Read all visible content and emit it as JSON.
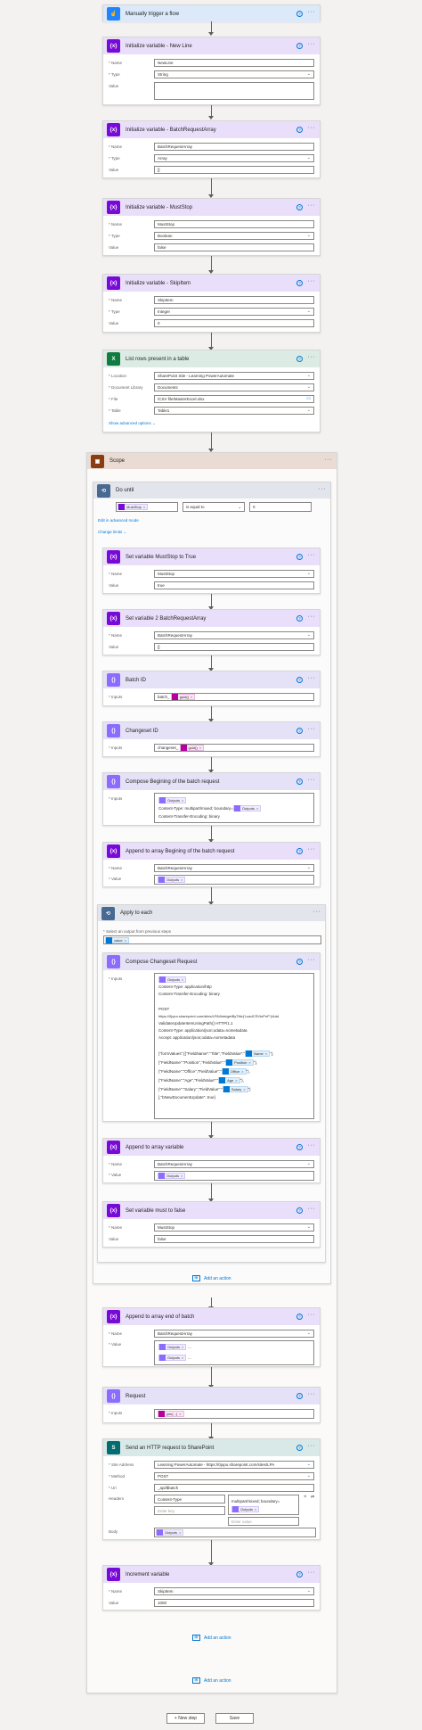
{
  "labels": {
    "name": "* Name",
    "type": "* Type",
    "value": "Value",
    "value_req": "* Value",
    "inputs": "* Inputs",
    "location": "* Location",
    "doclib": "* Document Library",
    "file": "* File",
    "table": "* Table",
    "site": "* Site Address",
    "method": "* Method",
    "uri": "* Uri",
    "headers": "Headers",
    "body": "Body"
  },
  "trigger": {
    "title": "Manually trigger a flow"
  },
  "var_newline": {
    "title": "Initialize variable - New Line",
    "name": "NewLine",
    "type": "String",
    "value": ""
  },
  "var_batch": {
    "title": "Initialize variable - BatchRequestArray",
    "name": "BatchRequestArray",
    "type": "Array",
    "value": "[]"
  },
  "var_muststop": {
    "title": "Initialize variable - MustStop",
    "name": "MustStop",
    "type": "Boolean",
    "value": "false"
  },
  "var_skip": {
    "title": "Initialize variable - SkipItem",
    "name": "SkipItem",
    "type": "Integer",
    "value": "0"
  },
  "list_rows": {
    "title": "List rows present in a table",
    "location": "SharePoint Site - Learning PowerAutomate",
    "doclib": "Documents",
    "file": "/CSV file/MasterExcel.xlsx",
    "table": "Table1",
    "advanced": "Show advanced options"
  },
  "scope": {
    "title": "Scope"
  },
  "do_until": {
    "title": "Do until",
    "token": "MustStop",
    "operator": "is equal to",
    "value": "0",
    "edit_advanced": "Edit in advanced mode",
    "change_limits": "Change limits"
  },
  "set_muststop_true": {
    "title": "Set variable MustStop to True",
    "name": "MustStop",
    "value": "true"
  },
  "set_var2": {
    "title": "Set variable 2 BatchRequestArray",
    "name": "BatchRequestArray",
    "value": "[]"
  },
  "batch_id": {
    "title": "Batch ID",
    "prefix": "batch_",
    "token": "guid()"
  },
  "changeset_id": {
    "title": "Changeset ID",
    "prefix": "changeset_",
    "token": "guid()"
  },
  "compose_begin": {
    "title": "Compose Begining of the batch request",
    "token": "Outputs",
    "line1": "Content-Type: multipart/mixed; boundary=",
    "line2": "Content-Transfer-Encoding: binary"
  },
  "append_begin": {
    "title": "Append to array Begining of the batch request",
    "name": "BatchRequestArray",
    "token": "Outputs"
  },
  "apply_each": {
    "title": "Apply to each",
    "select_label": "* Select an output from previous steps",
    "token": "value"
  },
  "compose_changeset": {
    "title": "Compose Changeset Request",
    "token": "Outputs",
    "lines": [
      "Content-Type: application/http",
      "Content-Transfer-Encoding: binary",
      "",
      "POST",
      "https://0jopo.sharepoint.com/sites/LPA/lists/getByTitle('LoadCSVtoPnP')/Add",
      "ValidateUpdateItemUsingPath() HTTP/1.1",
      "Content-Type: application/json;odata=nometadata",
      "Accept: application/json;odata=nometadata",
      ""
    ],
    "json_lines": [
      {
        "pre": "{\"formValues\":[{\"FieldName\":\"Title\",\"FieldValue\":\"",
        "tok": "Name",
        "post": "\"},"
      },
      {
        "pre": "{\"FieldName\":\"Position\",\"FieldValue\":\"",
        "tok": "Position",
        "post": "\"},"
      },
      {
        "pre": "{\"FieldName\":\"Office\",\"FieldValue\":\"",
        "tok": "Office",
        "post": "\"},"
      },
      {
        "pre": "{\"FieldName\":\"Age\",\"FieldValue\":\"",
        "tok": "Age",
        "post": "\"},"
      },
      {
        "pre": "{\"FieldName\":\"Salary\",\"FieldValue\":\"",
        "tok": "Salary",
        "post": "\"}"
      }
    ],
    "tail": "],\"bNewDocumentUpdate\": true}"
  },
  "append_var": {
    "title": "Append to array variable",
    "name": "BatchRequestArray",
    "token": "Outputs"
  },
  "set_must_false": {
    "title": "Set variable must to false",
    "name": "MustStop",
    "value": "false"
  },
  "add_action": "Add an action",
  "append_end": {
    "title": "Append to array end of batch",
    "name": "BatchRequestArray",
    "token1": "Outputs",
    "token2": "Outputs"
  },
  "request": {
    "title": "Request",
    "token": "join(...)"
  },
  "http": {
    "title": "Send an HTTP request to SharePoint",
    "site": "Learning PowerAutomate - https://0jopo.sharepoint.com/sites/LPA",
    "method": "POST",
    "uri": "_api/$batch",
    "h_key": "Content-Type",
    "h_val": "multipart/mixed; boundary=",
    "h_key_ph": "Enter key",
    "h_val_ph": "Enter value",
    "h_token": "Outputs",
    "body_token": "Outputs"
  },
  "increment": {
    "title": "Increment variable",
    "name": "SkipItem",
    "value": "1000"
  },
  "footer": {
    "new_step": "+ New step",
    "save": "Save"
  }
}
